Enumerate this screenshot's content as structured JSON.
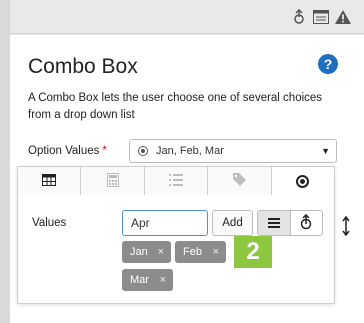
{
  "toolbar": {
    "icons": [
      "pin-icon",
      "list-icon",
      "warning-icon"
    ]
  },
  "panel": {
    "title": "Combo Box",
    "description": "A Combo Box lets the user choose one of several choices from a drop down list",
    "help_icon": "?"
  },
  "option_values": {
    "label": "Option Values",
    "required_mark": "*",
    "selected_value": "Jan, Feb, Mar"
  },
  "popup": {
    "tabs": [
      {
        "name": "table-tab",
        "active": false
      },
      {
        "name": "calculator-tab",
        "active": false
      },
      {
        "name": "list-tab",
        "active": false
      },
      {
        "name": "tag-tab",
        "active": false
      },
      {
        "name": "radio-tab",
        "active": true
      }
    ],
    "values_label": "Values",
    "input_value": "Apr",
    "add_label": "Add",
    "chips": [
      "Jan",
      "Feb",
      "Mar"
    ],
    "chip_remove": "×"
  },
  "badge": "2",
  "colors": {
    "accent": "#4a90d9",
    "badge": "#8dc63f",
    "chip": "#8c8c8c",
    "help": "#1f6fbf",
    "required": "#d0021b"
  }
}
